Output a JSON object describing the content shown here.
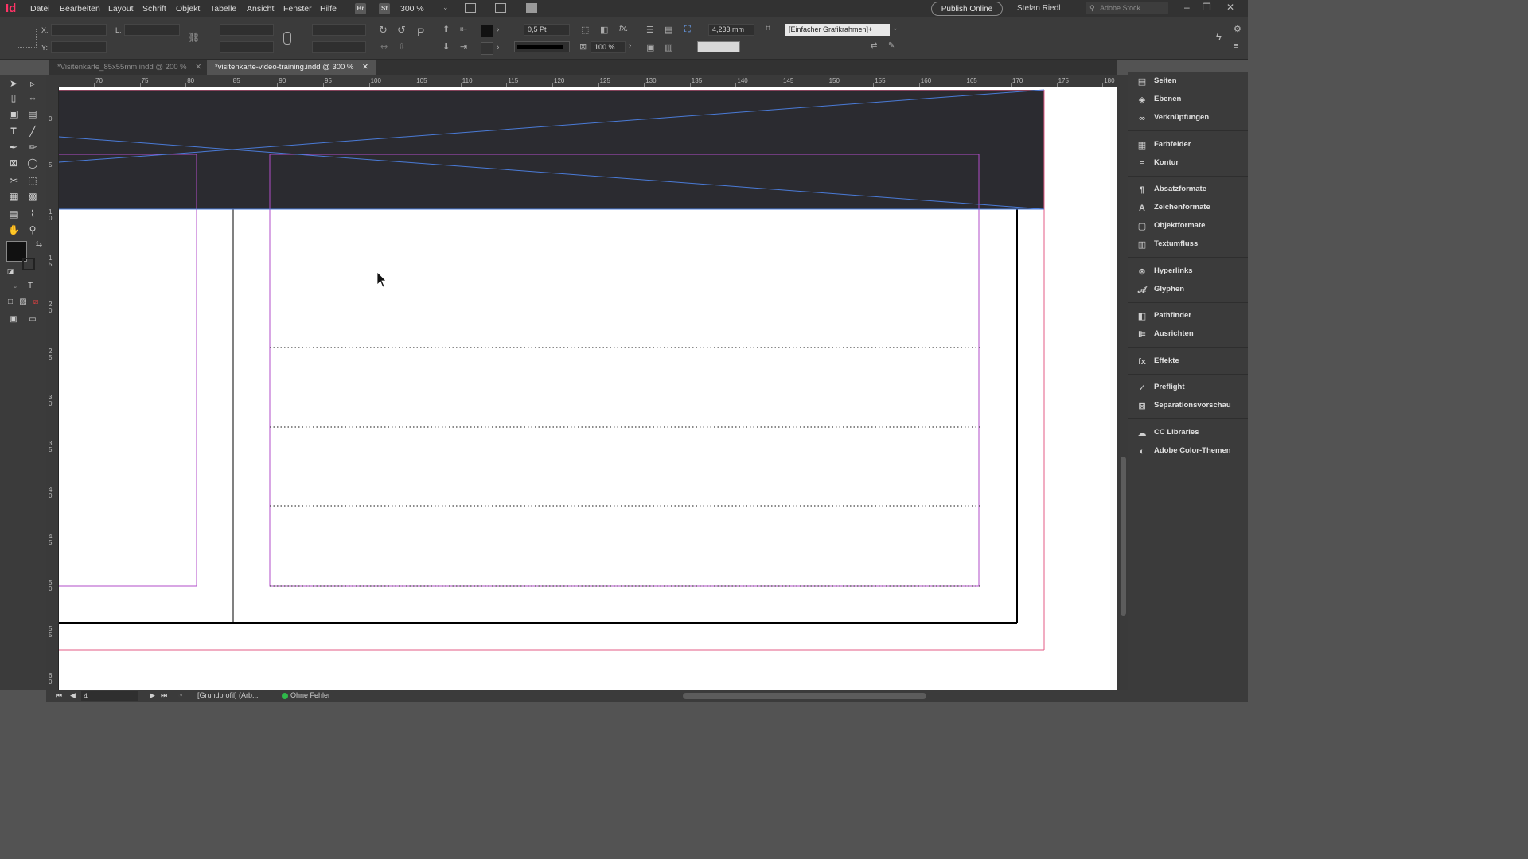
{
  "app": {
    "logo": "Id"
  },
  "menu": [
    "Datei",
    "Bearbeiten",
    "Layout",
    "Schrift",
    "Objekt",
    "Tabelle",
    "Ansicht",
    "Fenster",
    "Hilfe"
  ],
  "menubar": {
    "bridge_label": "Br",
    "stock_label": "St",
    "zoom": "300 %",
    "publish": "Publish Online",
    "user": "Stefan Riedl",
    "search_placeholder": "Adobe Stock"
  },
  "control": {
    "x_label": "X:",
    "y_label": "Y:",
    "l_label": "L:",
    "stroke_weight": "0,5 Pt",
    "scale": "100 %",
    "fitting_offset": "4,233 mm",
    "object_style": "[Einfacher Grafikrahmen]+"
  },
  "tabs": [
    {
      "label": "*Visitenkarte_85x55mm.indd @ 200 %",
      "active": false
    },
    {
      "label": "*visitenkarte-video-training.indd @ 300 %",
      "active": true
    }
  ],
  "ruler": {
    "horizontal": [
      "70",
      "75",
      "80",
      "85",
      "90",
      "95",
      "100",
      "105",
      "110",
      "115",
      "120",
      "125",
      "130",
      "135",
      "140",
      "145",
      "150",
      "155",
      "160",
      "165",
      "170",
      "175",
      "180"
    ],
    "vertical": [
      "0",
      "5",
      "10",
      "15",
      "20",
      "25",
      "30",
      "35",
      "40",
      "45",
      "50",
      "55",
      "60"
    ]
  },
  "panels": [
    {
      "label": "Seiten",
      "icon": "pages-icon"
    },
    {
      "label": "Ebenen",
      "icon": "layers-icon"
    },
    {
      "label": "Verknüpfungen",
      "icon": "links-icon"
    },
    {
      "label": "Farbfelder",
      "icon": "swatches-icon"
    },
    {
      "label": "Kontur",
      "icon": "stroke-icon"
    },
    {
      "label": "Absatzformate",
      "icon": "paragraph-styles-icon"
    },
    {
      "label": "Zeichenformate",
      "icon": "character-styles-icon"
    },
    {
      "label": "Objektformate",
      "icon": "object-styles-icon"
    },
    {
      "label": "Textumfluss",
      "icon": "text-wrap-icon"
    },
    {
      "label": "Hyperlinks",
      "icon": "hyperlinks-icon"
    },
    {
      "label": "Glyphen",
      "icon": "glyphs-icon"
    },
    {
      "label": "Pathfinder",
      "icon": "pathfinder-icon"
    },
    {
      "label": "Ausrichten",
      "icon": "align-icon"
    },
    {
      "label": "Effekte",
      "icon": "effects-icon"
    },
    {
      "label": "Preflight",
      "icon": "preflight-icon"
    },
    {
      "label": "Separationsvorschau",
      "icon": "separations-icon"
    },
    {
      "label": "CC Libraries",
      "icon": "cc-libraries-icon"
    },
    {
      "label": "Adobe Color-Themen",
      "icon": "color-themes-icon"
    }
  ],
  "status": {
    "page": "4",
    "profile": "[Grundprofil] (Arb...",
    "preflight": "Ohne Fehler"
  },
  "colors": {
    "dark_band": "#2b2b30",
    "margin_guide": "#b04cc8",
    "bleed_guide": "#e35b86",
    "frame_line": "#4a7bd8",
    "preflight_ok": "#2fb84a",
    "app_accent": "#ff3366"
  }
}
